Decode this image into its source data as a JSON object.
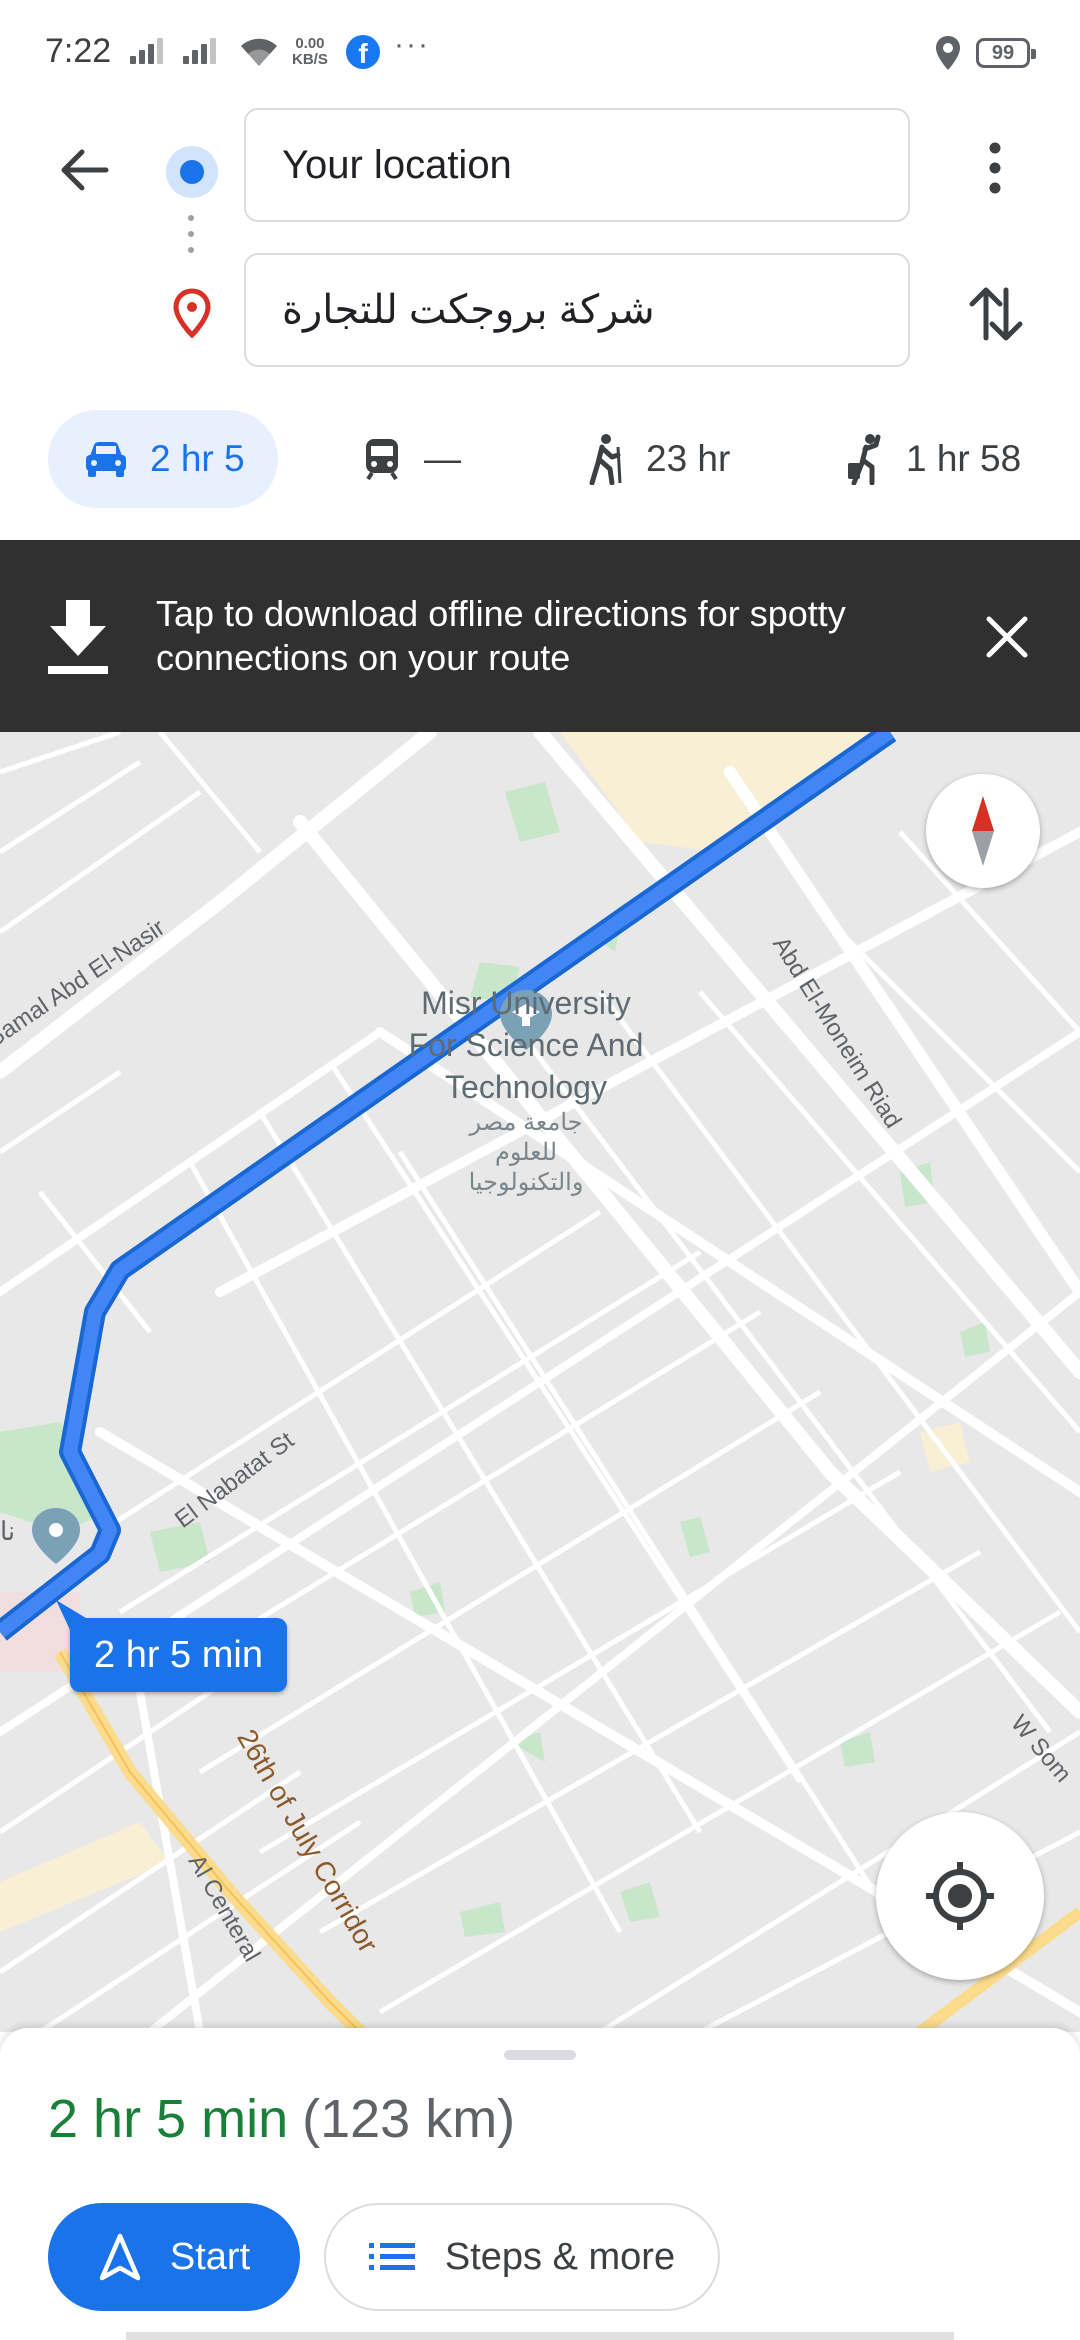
{
  "status_bar": {
    "time": "7:22",
    "net_speed_value": "0.00",
    "net_speed_unit": "KB/S",
    "overflow": "···",
    "battery": "99"
  },
  "directions": {
    "origin_value": "Your location",
    "destination_value": "شركة بروجكت للتجارة"
  },
  "modes": [
    {
      "name": "driving",
      "label": "2 hr 5",
      "active": true
    },
    {
      "name": "transit",
      "label": "—",
      "active": false
    },
    {
      "name": "walking",
      "label": "23 hr",
      "active": false
    },
    {
      "name": "rideshare",
      "label": "1 hr 58",
      "active": false
    }
  ],
  "banner": {
    "text": "Tap to download offline directions for spotty connections on your route"
  },
  "map": {
    "route_color": "#4285f4",
    "poi": {
      "name_en": "Misr University For Science And Technology",
      "name_ar": "جامعة مصر للعلوم والتكنولوجيا"
    },
    "streets": {
      "gamal": "Gamal Abd El-Nasir",
      "moneim": "Abd El-Moneim Riad",
      "nabatat": "El Nabatat St",
      "corridor": "26th of July Corridor",
      "centeral": "Al Centeral",
      "wsom": "W Som"
    },
    "left_poi_fragment": "نا",
    "route_duration_label": "2 hr 5 min"
  },
  "sheet": {
    "duration": "2 hr 5 min",
    "distance": "(123 km)",
    "start_label": "Start",
    "steps_label": "Steps & more"
  },
  "colors": {
    "accent": "#1a73e8",
    "duration_green": "#188038",
    "banner_bg": "#303030"
  }
}
